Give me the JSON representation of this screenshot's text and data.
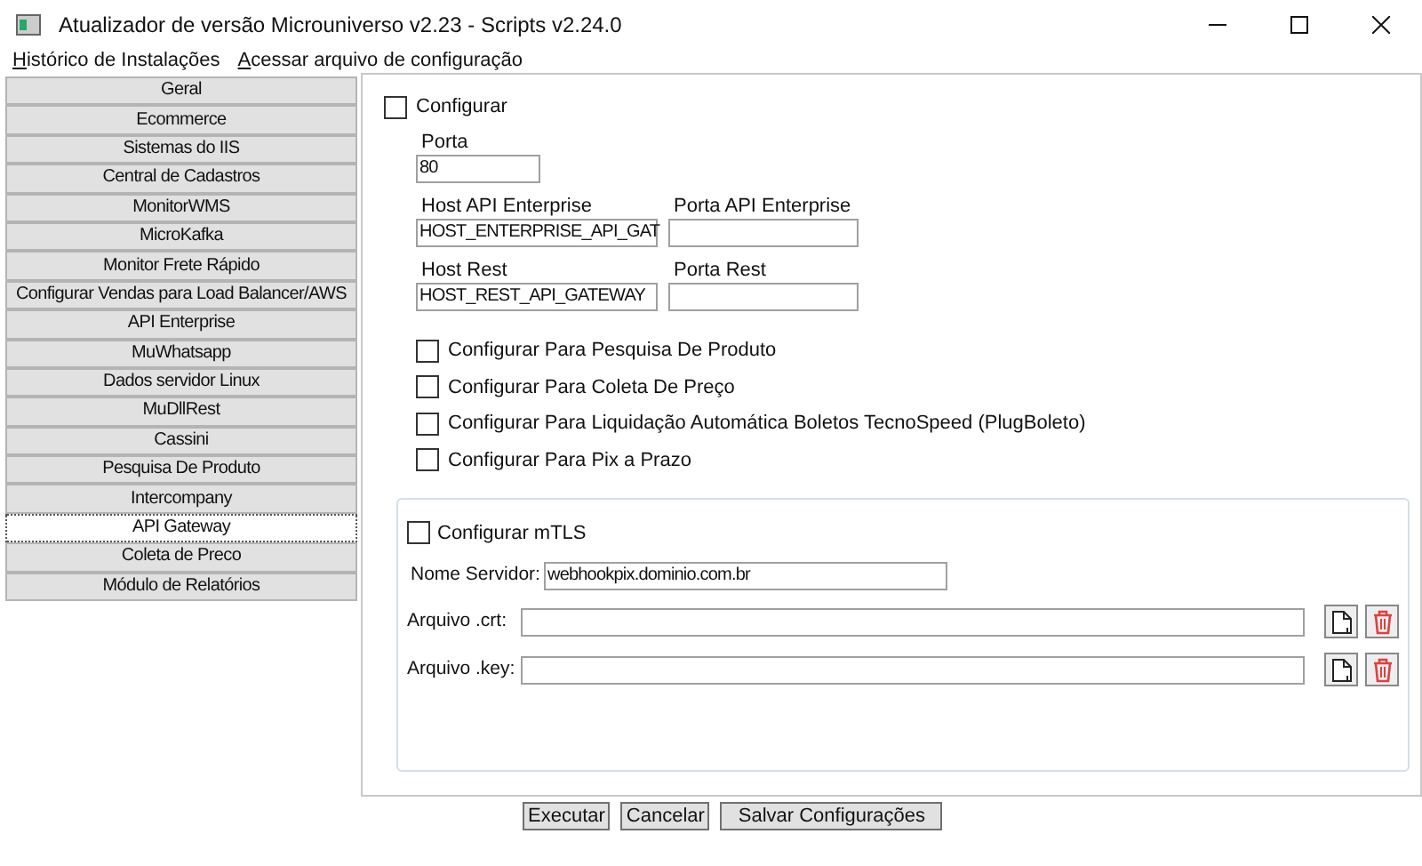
{
  "window": {
    "title": "Atualizador de versão Microuniverso v2.23 - Scripts v2.24.0"
  },
  "menu": [
    "Histórico de Instalações",
    "Acessar arquivo de configuração"
  ],
  "tabs": [
    {
      "label": "Geral",
      "selected": false
    },
    {
      "label": "Ecommerce",
      "selected": false
    },
    {
      "label": "Sistemas do IIS",
      "selected": false
    },
    {
      "label": "Central de Cadastros",
      "selected": false
    },
    {
      "label": "MonitorWMS",
      "selected": false
    },
    {
      "label": "MicroKafka",
      "selected": false
    },
    {
      "label": "Monitor Frete Rápido",
      "selected": false
    },
    {
      "label": "Configurar Vendas para Load Balancer/AWS",
      "selected": false
    },
    {
      "label": "API Enterprise",
      "selected": false
    },
    {
      "label": "MuWhatsapp",
      "selected": false
    },
    {
      "label": "Dados servidor Linux",
      "selected": false
    },
    {
      "label": "MuDllRest",
      "selected": false
    },
    {
      "label": "Cassini",
      "selected": false
    },
    {
      "label": "Pesquisa De Produto",
      "selected": false
    },
    {
      "label": "Intercompany",
      "selected": false
    },
    {
      "label": "API Gateway",
      "selected": true
    },
    {
      "label": "Coleta de Preco",
      "selected": false
    },
    {
      "label": "Módulo de Relatórios",
      "selected": false
    }
  ],
  "configurar": {
    "label": "Configurar",
    "checked": false
  },
  "porta": {
    "label": "Porta",
    "value": "80"
  },
  "host_api_enterprise": {
    "label": "Host API Enterprise",
    "value": "HOST_ENTERPRISE_API_GAT"
  },
  "porta_api_enterprise": {
    "label": "Porta API Enterprise"
  },
  "host_rest": {
    "label": "Host Rest",
    "value": "HOST_REST_API_GATEWAY"
  },
  "porta_rest": {
    "label": "Porta Rest"
  },
  "options": [
    {
      "label": "Configurar Para Pesquisa De Produto",
      "checked": false
    },
    {
      "label": "Configurar Para Coleta De Preço",
      "checked": false
    },
    {
      "label": "Configurar Para Liquidação Automática Boletos TecnoSpeed (PlugBoleto)",
      "checked": false
    },
    {
      "label": "Configurar Para Pix a Prazo",
      "checked": false
    }
  ],
  "mtls": {
    "label": "Configurar mTLS",
    "checked": false,
    "server_label": "Nome Servidor:",
    "server_value": "webhookpix.dominio.com.br",
    "files": [
      {
        "label": "Arquivo .crt:"
      },
      {
        "label": "Arquivo .key:"
      }
    ]
  },
  "buttons": [
    "Executar",
    "Cancelar",
    "Salvar Configurações"
  ]
}
